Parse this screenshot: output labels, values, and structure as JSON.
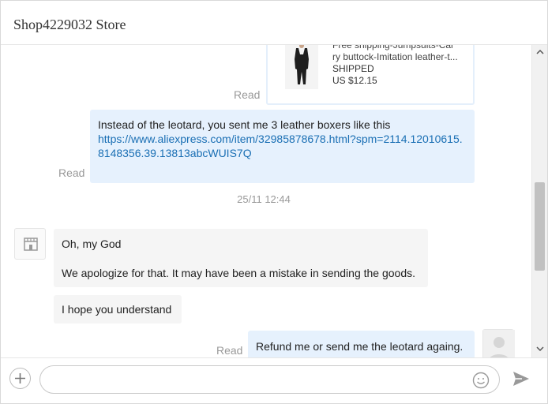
{
  "header": {
    "title": "Shop4229032 Store"
  },
  "product": {
    "title_line1": "Free shipping-Jumpsuits-Car",
    "title_line2": "ry buttock-Imitation leather-t...",
    "status": "SHIPPED",
    "price": "US $12.15"
  },
  "messages": {
    "read_label": "Read",
    "out1_text": "Instead of the leotard, you sent me 3 leather boxers like this",
    "out1_link": "https://www.aliexpress.com/item/32985878678.html?spm=2114.12010615.8148356.39.13813abcWUIS7Q",
    "timestamp": "25/11 12:44",
    "in1_line1": "Oh, my God",
    "in1_line2": "We apologize for that. It may have been a mistake in sending the goods.",
    "in2_text": "I hope you understand",
    "out2_text": "Refund me or send me the leotard againg."
  },
  "composer": {
    "placeholder": ""
  },
  "icons": {
    "plus": "plus-icon",
    "emoji": "emoji-icon",
    "send": "send-icon",
    "shop_avatar": "store-icon",
    "user_avatar": "user-icon"
  },
  "colors": {
    "outgoing_bubble": "#e6f1fd",
    "incoming_bubble": "#f5f5f5",
    "link": "#1a6fb4",
    "read_text": "#999999"
  }
}
